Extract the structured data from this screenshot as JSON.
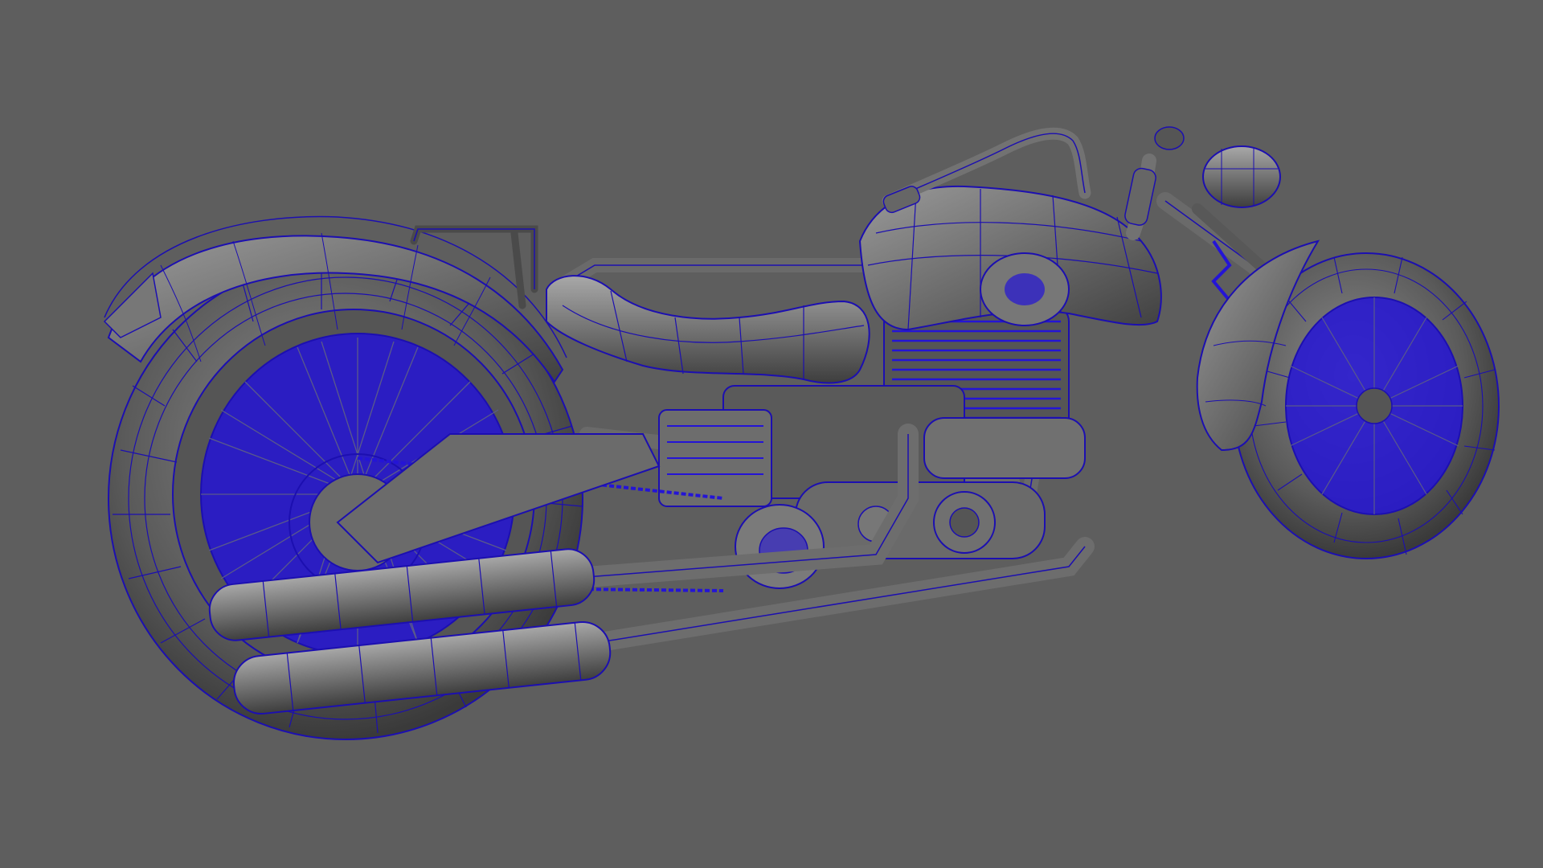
{
  "viewport": {
    "background_color": "#5e5e5e",
    "shading": "smooth-shade-wireframe-on-shaded",
    "model_name": "chopper-motorcycle"
  },
  "colors": {
    "wire": "#1c0fb0",
    "wire_dense": "#2414d6",
    "shade_dark": "#3f3f3f",
    "shade_mid": "#666666",
    "shade_light": "#8a8a8a",
    "shade_highlight": "#a6a6a6"
  }
}
